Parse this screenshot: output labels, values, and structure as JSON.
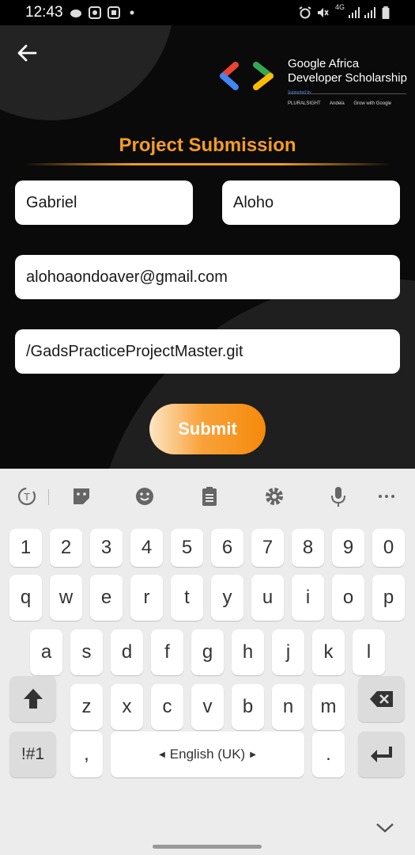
{
  "status_bar": {
    "time": "12:43",
    "network": "4G",
    "icons": [
      "notification-icon",
      "gallery-icon",
      "photo-icon",
      "dot-icon",
      "alarm-icon",
      "mute-icon",
      "signal-icon",
      "signal-icon",
      "battery-icon"
    ]
  },
  "header": {
    "back_icon": "arrow-left-icon",
    "logo": {
      "title_line1": "Google Africa",
      "title_line2": "Developer Scholarship",
      "supported_by": "Supported by",
      "partners": [
        "PLURALSIGHT",
        "Andela",
        "Grow with Google"
      ],
      "colors": [
        "#ea4335",
        "#4285f4",
        "#34a853",
        "#fbbc05"
      ]
    }
  },
  "form": {
    "title": "Project Submission",
    "first_name": "Gabriel",
    "last_name": "Aloho",
    "email": "alohoaondoaver@gmail.com",
    "github_link": "/GadsPracticeProjectMaster.git",
    "submit_label": "Submit",
    "accent_color": "#f39c25"
  },
  "keyboard": {
    "toolbar": [
      "translate-icon",
      "sticker-icon",
      "emoji-icon",
      "clipboard-icon",
      "settings-icon",
      "microphone-icon",
      "more-icon"
    ],
    "number_row": [
      "1",
      "2",
      "3",
      "4",
      "5",
      "6",
      "7",
      "8",
      "9",
      "0"
    ],
    "row1": [
      "q",
      "w",
      "e",
      "r",
      "t",
      "y",
      "u",
      "i",
      "o",
      "p"
    ],
    "row2": [
      "a",
      "s",
      "d",
      "f",
      "g",
      "h",
      "j",
      "k",
      "l"
    ],
    "row3": [
      "z",
      "x",
      "c",
      "v",
      "b",
      "n",
      "m"
    ],
    "symbols_key": "!#1",
    "comma_key": ",",
    "period_key": ".",
    "space_label": "English (UK)"
  }
}
